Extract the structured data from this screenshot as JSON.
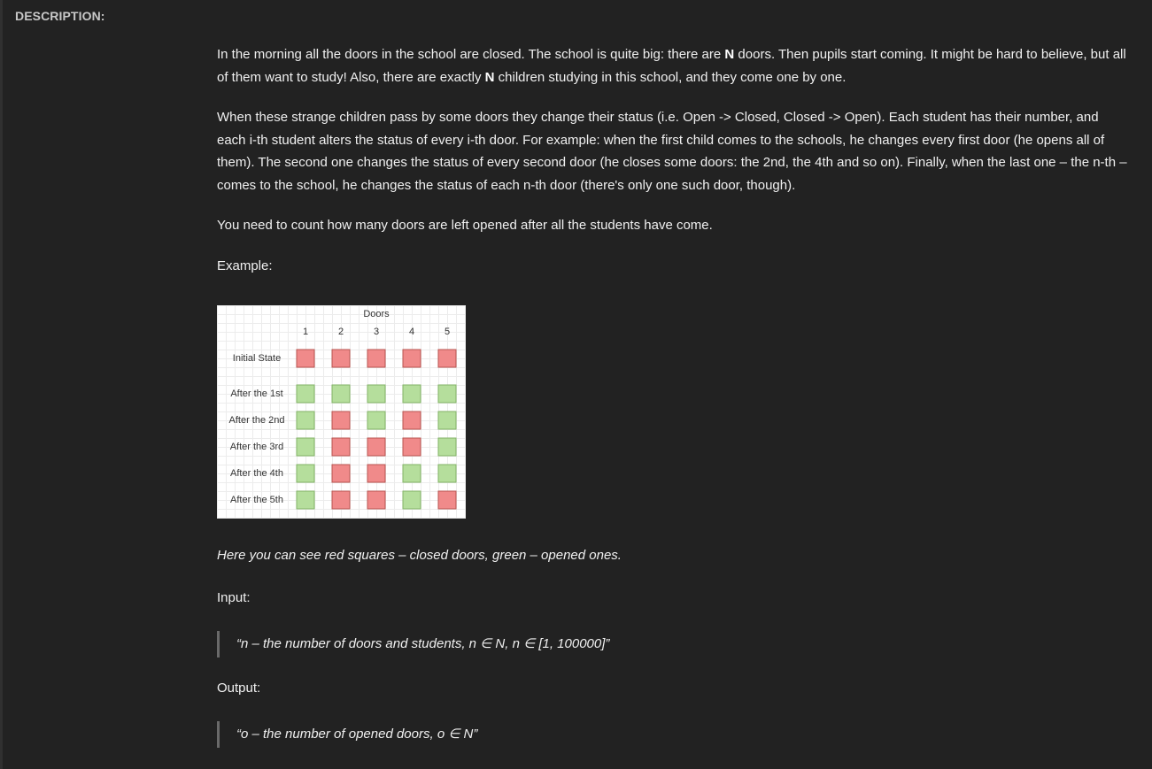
{
  "header": {
    "title": "DESCRIPTION:"
  },
  "description": {
    "p1": [
      "In the morning all the doors in the school are closed. The school is quite big: there are ",
      "N",
      " doors. Then pupils start coming. It might be hard to believe, but all of them want to study! Also, there are exactly ",
      "N",
      " children studying in this school, and they come one by one."
    ],
    "p2": "When these strange children pass by some doors they change their status (i.e. Open -> Closed, Closed -> Open). Each student has their number, and each i-th student alters the status of every i-th door. For example: when the first child comes to the schools, he changes every first door (he opens all of them). The second one changes the status of every second door (he closes some doors: the 2nd, the 4th and so on). Finally, when the last one – the n-th – comes to the school, he changes the status of each n-th door (there's only one such door, though).",
    "p3": "You need to count how many doors are left opened after all the students have come.",
    "example_label": "Example:"
  },
  "example_table": {
    "caption": "Doors",
    "columns": [
      "1",
      "2",
      "3",
      "4",
      "5"
    ],
    "rows": [
      {
        "label": "Initial State",
        "states": [
          "closed",
          "closed",
          "closed",
          "closed",
          "closed"
        ]
      },
      {
        "label": "After the 1st",
        "states": [
          "open",
          "open",
          "open",
          "open",
          "open"
        ]
      },
      {
        "label": "After the 2nd",
        "states": [
          "open",
          "closed",
          "open",
          "closed",
          "open"
        ]
      },
      {
        "label": "After the 3rd",
        "states": [
          "open",
          "closed",
          "closed",
          "closed",
          "open"
        ]
      },
      {
        "label": "After the 4th",
        "states": [
          "open",
          "closed",
          "closed",
          "open",
          "open"
        ]
      },
      {
        "label": "After the 5th",
        "states": [
          "open",
          "closed",
          "closed",
          "open",
          "closed"
        ]
      }
    ],
    "colors": {
      "closed_fill": "#f08a8a",
      "closed_stroke": "#b85450",
      "open_fill": "#b5de9c",
      "open_stroke": "#82b366"
    }
  },
  "note": "Here you can see red squares – closed doors, green – opened ones.",
  "input": {
    "label": "Input:",
    "quote": "“n – the number of doors and students, n ∈ N, n ∈ [1, 100000]”"
  },
  "output": {
    "label": "Output:",
    "quote": "“o – the number of opened doors, o ∈ N”"
  }
}
